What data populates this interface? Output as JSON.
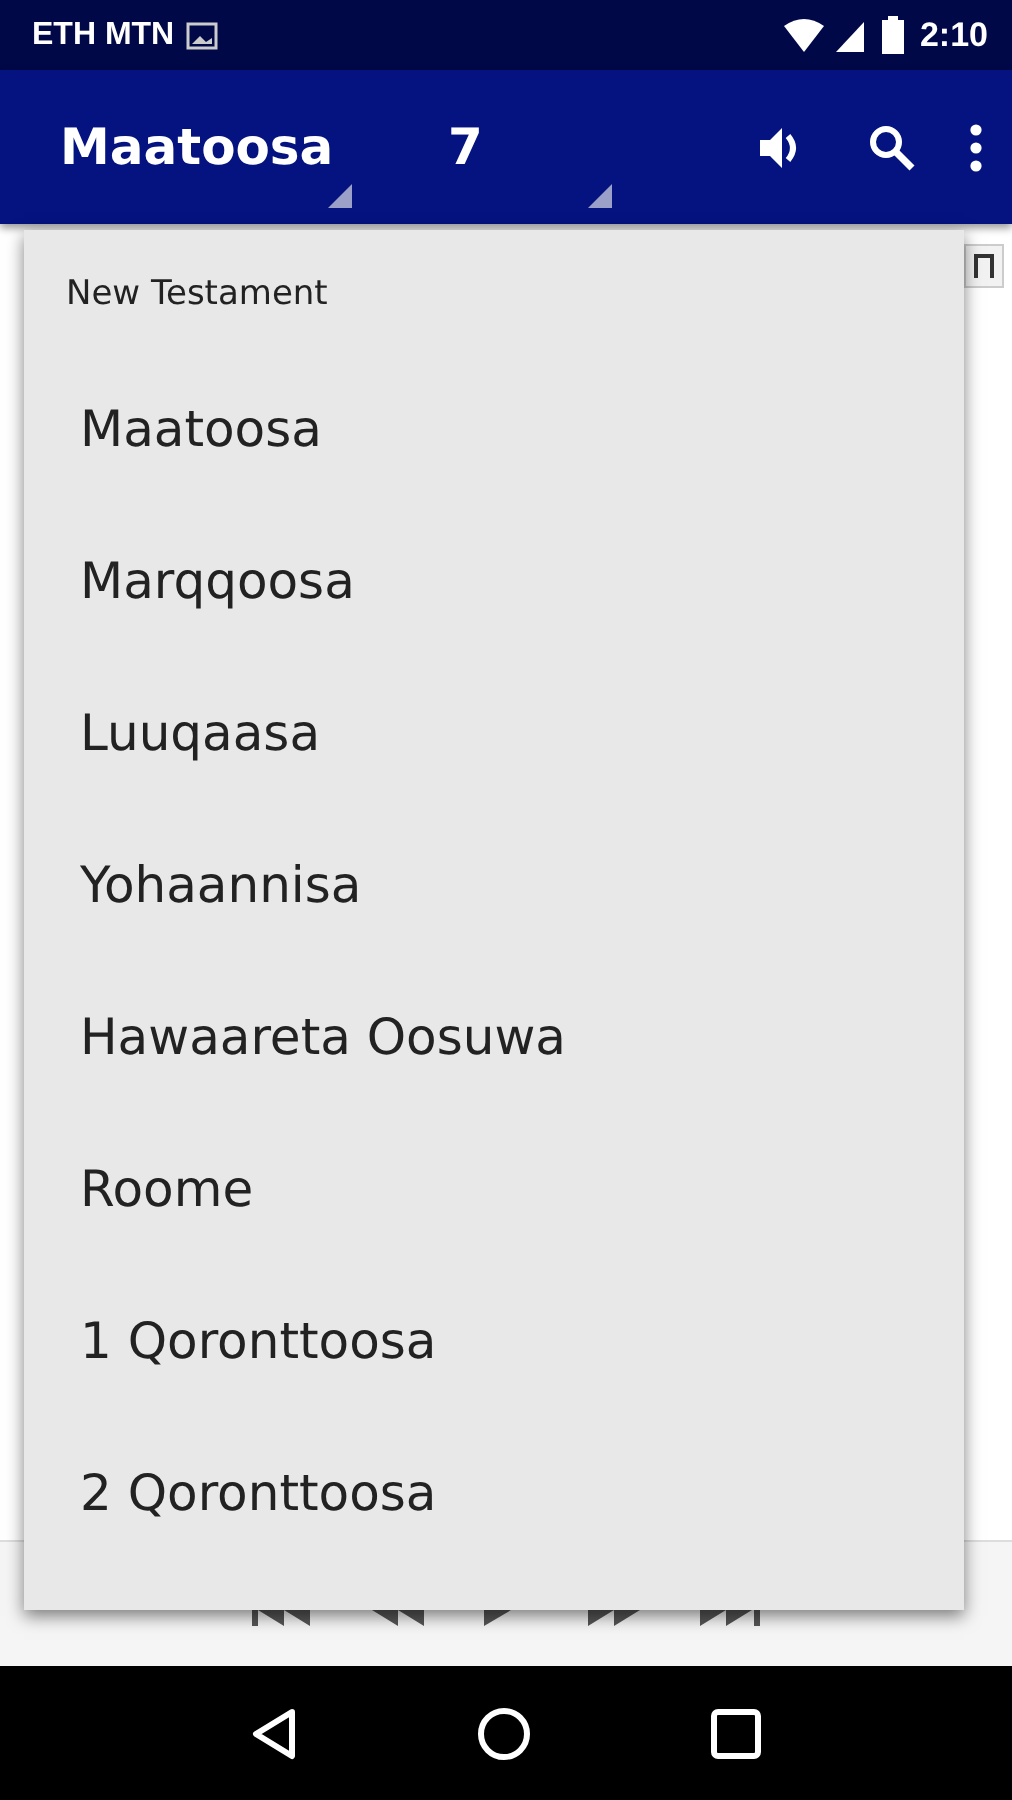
{
  "status_bar": {
    "carrier": "ETH MTN",
    "time": "2:10"
  },
  "app_bar": {
    "book": "Maatoosa",
    "chapter": "7"
  },
  "book_menu": {
    "heading": "New Testament",
    "items": [
      "Maatoosa",
      "Marqqoosa",
      "Luuqaasa",
      "Yohaannisa",
      "Hawaareta Oosuwa",
      "Roome",
      "1 Qoronttoosa",
      "2 Qoronttoosa"
    ]
  }
}
